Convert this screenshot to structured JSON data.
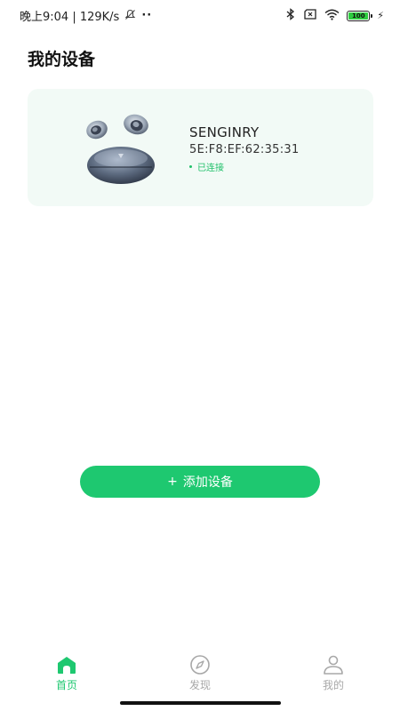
{
  "status_bar": {
    "time_text": "晚上9:04 | 129K/s",
    "battery_level": "100"
  },
  "page": {
    "title": "我的设备"
  },
  "device": {
    "name": "SENGINRY",
    "mac": "5E:F8:EF:62:35:31",
    "status": "已连接"
  },
  "actions": {
    "add_device_icon": "+",
    "add_device_label": "添加设备"
  },
  "nav": {
    "items": [
      {
        "label": "首页",
        "icon": "home-icon",
        "active": true
      },
      {
        "label": "发现",
        "icon": "compass-icon",
        "active": false
      },
      {
        "label": "我的",
        "icon": "person-icon",
        "active": false
      }
    ]
  },
  "colors": {
    "accent": "#1ec870",
    "card_bg": "#f2faf6",
    "inactive": "#a8a8a8"
  }
}
